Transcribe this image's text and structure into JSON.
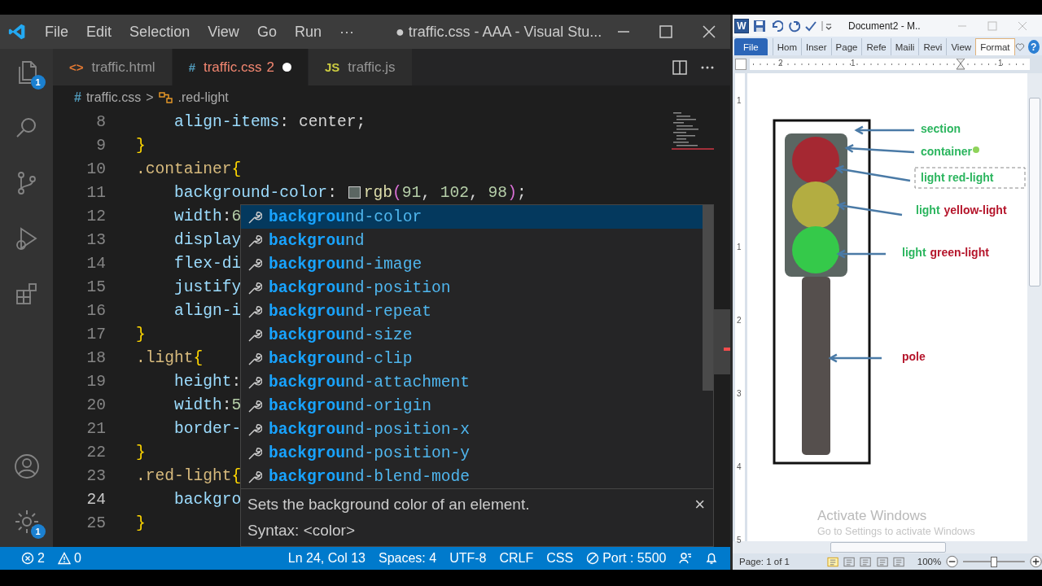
{
  "vscode": {
    "title_bar": {
      "menus": [
        "File",
        "Edit",
        "Selection",
        "View",
        "Go",
        "Run",
        "···"
      ],
      "title": "● traffic.css - AAA - Visual Stu..."
    },
    "activity_bar": {
      "explorer_badge": "1",
      "settings_badge": "1"
    },
    "tabs": [
      {
        "icon": "<>",
        "label": "traffic.html",
        "dirty": false,
        "selected": false
      },
      {
        "icon": "#",
        "label": "traffic.css",
        "problems": "2",
        "dirty": true,
        "selected": true
      },
      {
        "icon": "JS",
        "label": "traffic.js",
        "dirty": false,
        "selected": false
      }
    ],
    "breadcrumb": {
      "icon": "#",
      "file": "traffic.css",
      "separator": ">",
      "symbol": ".red-light"
    },
    "editor": {
      "lines": [
        {
          "number": "8",
          "current": false,
          "tokens": [
            {
              "text": "align-items",
              "kind": "property"
            },
            {
              "text": ": ",
              "kind": "punct"
            },
            {
              "text": "center",
              "kind": "value"
            },
            {
              "text": ";",
              "kind": "punct"
            }
          ]
        },
        {
          "number": "9",
          "current": false,
          "tokens": [
            {
              "text": "}",
              "kind": "brace"
            }
          ]
        },
        {
          "number": "10",
          "current": false,
          "tokens": [
            {
              "text": ".container",
              "kind": "selector"
            },
            {
              "text": "{",
              "kind": "brace"
            }
          ]
        },
        {
          "number": "11",
          "current": false,
          "tokens": [
            {
              "text": "background-color",
              "kind": "property"
            },
            {
              "text": ": ",
              "kind": "punct"
            },
            {
              "kind": "swatch",
              "color": "#5b6662"
            },
            {
              "text": "rgb",
              "kind": "func"
            },
            {
              "text": "(",
              "kind": "paren"
            },
            {
              "text": "91",
              "kind": "number"
            },
            {
              "text": ", ",
              "kind": "punct"
            },
            {
              "text": "102",
              "kind": "number"
            },
            {
              "text": ", ",
              "kind": "punct"
            },
            {
              "text": "98",
              "kind": "number"
            },
            {
              "text": ")",
              "kind": "paren"
            },
            {
              "text": ";",
              "kind": "punct"
            }
          ]
        },
        {
          "number": "12",
          "current": false,
          "tokens": [
            {
              "text": "width",
              "kind": "property"
            },
            {
              "text": ":",
              "kind": "punct"
            },
            {
              "text": "6",
              "kind": "number"
            }
          ]
        },
        {
          "number": "13",
          "current": false,
          "tokens": [
            {
              "text": "display",
              "kind": "property"
            }
          ]
        },
        {
          "number": "14",
          "current": false,
          "tokens": [
            {
              "text": "flex-di",
              "kind": "property"
            }
          ]
        },
        {
          "number": "15",
          "current": false,
          "tokens": [
            {
              "text": "justify",
              "kind": "property"
            }
          ]
        },
        {
          "number": "16",
          "current": false,
          "tokens": [
            {
              "text": "align-i",
              "kind": "property"
            }
          ]
        },
        {
          "number": "17",
          "current": false,
          "tokens": [
            {
              "text": "}",
              "kind": "brace"
            }
          ]
        },
        {
          "number": "18",
          "current": false,
          "tokens": [
            {
              "text": ".light",
              "kind": "selector"
            },
            {
              "text": "{",
              "kind": "brace"
            }
          ]
        },
        {
          "number": "19",
          "current": false,
          "tokens": [
            {
              "text": "height",
              "kind": "property"
            },
            {
              "text": ":",
              "kind": "punct"
            }
          ]
        },
        {
          "number": "20",
          "current": false,
          "tokens": [
            {
              "text": "width",
              "kind": "property"
            },
            {
              "text": ":",
              "kind": "punct"
            },
            {
              "text": "5",
              "kind": "number"
            }
          ]
        },
        {
          "number": "21",
          "current": false,
          "tokens": [
            {
              "text": "border-",
              "kind": "property"
            }
          ]
        },
        {
          "number": "22",
          "current": false,
          "tokens": [
            {
              "text": "}",
              "kind": "brace"
            }
          ]
        },
        {
          "number": "23",
          "current": false,
          "tokens": [
            {
              "text": ".red-light",
              "kind": "selector"
            },
            {
              "text": "{",
              "kind": "brace"
            }
          ]
        },
        {
          "number": "24",
          "current": true,
          "tokens": [
            {
              "text": "backgro",
              "kind": "property"
            }
          ]
        },
        {
          "number": "25",
          "current": false,
          "tokens": [
            {
              "text": "}",
              "kind": "brace"
            }
          ]
        }
      ]
    },
    "suggestions": {
      "items": [
        {
          "label": "**backgrou**nd-color",
          "selected": true
        },
        {
          "label": "**backgrou**nd",
          "selected": false
        },
        {
          "label": "**backgrou**nd-image",
          "selected": false
        },
        {
          "label": "**backgrou**nd-position",
          "selected": false
        },
        {
          "label": "**backgrou**nd-repeat",
          "selected": false
        },
        {
          "label": "**backgrou**nd-size",
          "selected": false
        },
        {
          "label": "**backgrou**nd-clip",
          "selected": false
        },
        {
          "label": "**backgrou**nd-attachment",
          "selected": false
        },
        {
          "label": "**backgrou**nd-origin",
          "selected": false
        },
        {
          "label": "**backgrou**nd-position-x",
          "selected": false
        },
        {
          "label": "**backgrou**nd-position-y",
          "selected": false
        },
        {
          "label": "**backgrou**nd-blend-mode",
          "selected": false
        }
      ],
      "description": "Sets the background color of an element.",
      "syntax": "Syntax: <color>",
      "close": "×"
    },
    "status_bar": {
      "errors": "2",
      "warnings": "0",
      "position": "Ln 24, Col 13",
      "spaces": "Spaces: 4",
      "encoding": "UTF-8",
      "eol": "CRLF",
      "language": "CSS",
      "port": "Port : 5500"
    }
  },
  "word": {
    "app_icon": "W",
    "title": "Document2 - M..",
    "ribbon_tabs": [
      {
        "label": "File",
        "kind": "file",
        "selected": false
      },
      {
        "label": "Hom",
        "kind": "tab",
        "selected": false
      },
      {
        "label": "Inser",
        "kind": "tab",
        "selected": false
      },
      {
        "label": "Page",
        "kind": "tab",
        "selected": false
      },
      {
        "label": "Refe",
        "kind": "tab",
        "selected": false
      },
      {
        "label": "Maili",
        "kind": "tab",
        "selected": false
      },
      {
        "label": "Revi",
        "kind": "tab",
        "selected": false
      },
      {
        "label": "View",
        "kind": "tab",
        "selected": false
      },
      {
        "label": "Format",
        "kind": "tab",
        "selected": true
      }
    ],
    "help": "?",
    "ruler_numbers": [
      "2",
      "1",
      "1"
    ],
    "vertical_ruler_numbers": [
      "1",
      "1",
      "2",
      "3",
      "4",
      "5"
    ],
    "document": {
      "lights": [
        {
          "color": "#a52832"
        },
        {
          "color": "#b3ad41"
        },
        {
          "color": "#35c94a"
        }
      ],
      "labels": [
        {
          "parts": [
            {
              "text": "section",
              "color": "#2bb55e"
            }
          ]
        },
        {
          "parts": [
            {
              "text": "container",
              "color": "#2bb55e"
            }
          ]
        },
        {
          "parts": [
            {
              "text": "light red-light",
              "color": "#2bb55e"
            }
          ]
        },
        {
          "parts": [
            {
              "text": "light",
              "color": "#2bb55e"
            },
            {
              "text": "yellow-light",
              "color": "#b5152b"
            }
          ]
        },
        {
          "parts": [
            {
              "text": "light",
              "color": "#2bb55e"
            },
            {
              "text": "green-light",
              "color": "#b5152b"
            }
          ]
        },
        {
          "parts": [
            {
              "text": "pole",
              "color": "#b5152b"
            }
          ]
        }
      ]
    },
    "watermark": {
      "title": "Activate Windows",
      "subtitle": "Go to Settings to activate Windows"
    },
    "status_bar": {
      "page": "Page: 1 of 1",
      "zoom": "100%"
    },
    "zoom_slider": {
      "level": 0.5
    }
  }
}
